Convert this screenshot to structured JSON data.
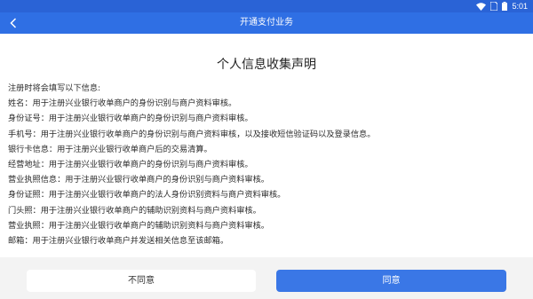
{
  "status_bar": {
    "time": "5:01"
  },
  "header": {
    "title": "开通支付业务"
  },
  "document": {
    "title": "个人信息收集声明",
    "intro": "注册时将会填写以下信息:",
    "lines": [
      "姓名：用于注册兴业银行收单商户的身份识别与商户资料审核。",
      "身份证号：用于注册兴业银行收单商户的身份识别与商户资料审核。",
      "手机号：用于注册兴业银行收单商户的身份识别与商户资料审核，以及接收短信验证码以及登录信息。",
      "银行卡信息：用于注册兴业银行收单商户后的交易清算。",
      "经营地址：用于注册兴业银行收单商户的身份识别与商户资料审核。",
      "营业执照信息：用于注册兴业银行收单商户的身份识别与商户资料审核。",
      "身份证照：用于注册兴业银行收单商户的法人身份识别资料与商户资料审核。",
      "门头照：用于注册兴业银行收单商户的辅助识别资料与商户资料审核。",
      "营业执照：用于注册兴业银行收单商户的辅助识别资料与商户资料审核。",
      "邮箱：用于注册兴业银行收单商户并发送相关信息至该邮箱。"
    ]
  },
  "footer": {
    "disagree_label": "不同意",
    "agree_label": "同意"
  },
  "icons": {
    "back": "back-arrow-icon",
    "wifi": "wifi-icon",
    "sim": "sim-card-icon",
    "battery": "battery-icon"
  },
  "colors": {
    "status_bar": "#2a63d6",
    "app_bar": "#2f6fe4",
    "primary_button": "#3a77e6",
    "footer_bg": "#f3f3f3"
  }
}
